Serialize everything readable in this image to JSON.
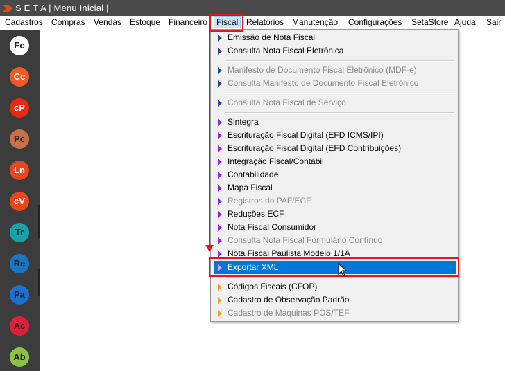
{
  "window": {
    "title": "S E T A | Menu Inicial |"
  },
  "menubar": {
    "items": [
      {
        "label": "Cadastros"
      },
      {
        "label": "Compras"
      },
      {
        "label": "Vendas"
      },
      {
        "label": "Estoque"
      },
      {
        "label": "Financeiro"
      },
      {
        "label": "Fiscal"
      },
      {
        "label": "Relatórios"
      },
      {
        "label": "Manutenção"
      },
      {
        "label": "Configurações"
      },
      {
        "label": "SetaStore"
      },
      {
        "label": "Ajuda"
      },
      {
        "label": "Sair"
      }
    ]
  },
  "dock": {
    "items": [
      {
        "label": "Fc",
        "color": "#ffffff"
      },
      {
        "label": "Cc",
        "color": "#f05a28"
      },
      {
        "label": "cP",
        "color": "#e8290f"
      },
      {
        "label": "Pc",
        "color": "#c8704a"
      },
      {
        "label": "Ln",
        "color": "#e8461d"
      },
      {
        "label": "cV",
        "color": "#e8461d"
      },
      {
        "label": "Tr",
        "color": "#17a2a8"
      },
      {
        "label": "Re",
        "color": "#1976c5"
      },
      {
        "label": "Pa",
        "color": "#1e6fcf"
      },
      {
        "label": "Ac",
        "color": "#e0203a"
      },
      {
        "label": "Ab",
        "color": "#8bc34a"
      }
    ]
  },
  "fiscal_menu": {
    "items": [
      {
        "label": "Emissão de Nota Fiscal",
        "enabled": true,
        "arrow_color": "#2a4a7a"
      },
      {
        "label": "Consulta Nota Fiscal Eletrônica",
        "enabled": true,
        "arrow_color": "#2a4a7a"
      },
      {
        "label": "Manifesto de Documento Fiscal Eletrônico (MDF-e)",
        "enabled": false,
        "arrow_color": "#2a4a7a"
      },
      {
        "label": "Consulta Manifesto de Documento Fiscal Eletrônico",
        "enabled": false,
        "arrow_color": "#2a4a7a"
      },
      {
        "label": "Consulta Nota Fiscal de Serviço",
        "enabled": false,
        "arrow_color": "#2a4a7a"
      },
      {
        "label": "Sintegra",
        "enabled": true,
        "arrow_color": "#8a2be2"
      },
      {
        "label": "Escrituração Fiscal Digital (EFD ICMS/IPI)",
        "enabled": true,
        "arrow_color": "#8a2be2"
      },
      {
        "label": "Escrituração Fiscal Digital (EFD Contribuições)",
        "enabled": true,
        "arrow_color": "#8a2be2"
      },
      {
        "label": "Integração Fiscal/Contábil",
        "enabled": true,
        "arrow_color": "#8a2be2"
      },
      {
        "label": "Contabilidade",
        "enabled": true,
        "arrow_color": "#8a2be2"
      },
      {
        "label": "Mapa Fiscal",
        "enabled": true,
        "arrow_color": "#8a2be2"
      },
      {
        "label": "Registros do PAF/ECF",
        "enabled": false,
        "arrow_color": "#8a2be2"
      },
      {
        "label": "Reduções ECF",
        "enabled": true,
        "arrow_color": "#8a2be2"
      },
      {
        "label": "Nota Fiscal Consumidor",
        "enabled": true,
        "arrow_color": "#8a2be2"
      },
      {
        "label": "Consulta Nota Fiscal Formulário Contínuo",
        "enabled": false,
        "arrow_color": "#8a2be2"
      },
      {
        "label": "Nota Fiscal Paulista Modelo 1/1A",
        "enabled": true,
        "arrow_color": "#8a2be2"
      },
      {
        "label": "Exportar XML",
        "enabled": true,
        "highlighted": true,
        "arrow_color": "#b06ad8"
      },
      {
        "label": "Códigos Fiscais (CFOP)",
        "enabled": true,
        "arrow_color": "#f0a030"
      },
      {
        "label": "Cadastro de Observação Padrão",
        "enabled": true,
        "arrow_color": "#f0a030"
      },
      {
        "label": "Cadastro de Maquinas POS/TEF",
        "enabled": false,
        "arrow_color": "#f0a030"
      }
    ]
  },
  "annotation_color": "#e8141b"
}
